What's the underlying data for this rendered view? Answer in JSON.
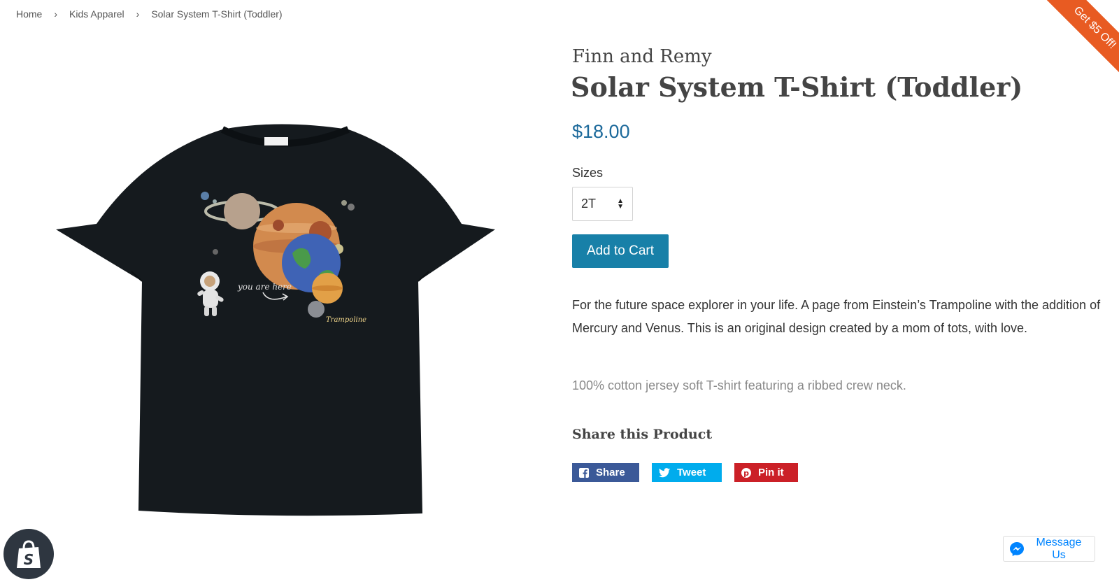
{
  "breadcrumb": {
    "home": "Home",
    "category": "Kids Apparel",
    "current": "Solar System T-Shirt (Toddler)",
    "separator": "›"
  },
  "product": {
    "vendor": "Finn and Remy",
    "title": "Solar System T-Shirt (Toddler)",
    "price": "$18.00",
    "size_label": "Sizes",
    "size_selected": "2T",
    "add_to_cart_label": "Add to Cart",
    "description": "For the future space explorer in your life. A page from Einstein’s Trampoline with the addition of Mercury and Venus. This is an original design created by a mom of tots, with love.",
    "material": "100% cotton jersey soft T-shirt featuring a ribbed crew neck.",
    "image_text": {
      "you_are_here": "you are here",
      "brand_mark": "Trampoline"
    }
  },
  "share": {
    "heading": "Share this Product",
    "facebook_label": "Share",
    "twitter_label": "Tweet",
    "pinterest_label": "Pin it"
  },
  "promo": {
    "label": "Get $5 Off!"
  },
  "messenger": {
    "label": "Message Us"
  },
  "colors": {
    "price": "#1d6a9b",
    "add_to_cart": "#1880a8",
    "facebook": "#3b5998",
    "twitter": "#00aced",
    "pinterest": "#cb2027",
    "promo": "#e85b22",
    "shirt": "#151a1e"
  }
}
